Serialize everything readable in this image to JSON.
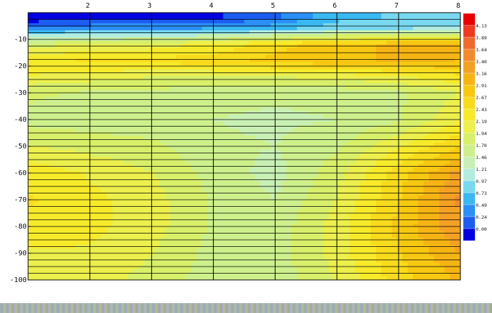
{
  "chart_data": {
    "type": "heatmap",
    "title": "",
    "xlabel": "",
    "ylabel": "",
    "x_ticks": [
      2,
      3,
      4,
      5,
      6,
      7,
      8
    ],
    "y_ticks": [
      -10,
      -20,
      -30,
      -40,
      -50,
      -60,
      -70,
      -80,
      -90,
      -100
    ],
    "x_tick_labels": [
      "2",
      "3",
      "4",
      "5",
      "6",
      "7",
      "8"
    ],
    "y_tick_labels": [
      "-10",
      "-20",
      "-30",
      "-40",
      "-50",
      "-60",
      "-70",
      "-80",
      "-90",
      "-100"
    ],
    "xlim": [
      1,
      8
    ],
    "ylim": [
      -100,
      0
    ],
    "x_grid": true,
    "y_grid_step": 2.5,
    "colorbar": {
      "levels": [
        0.0,
        0.24,
        0.49,
        0.73,
        0.97,
        1.21,
        1.46,
        1.7,
        1.94,
        2.19,
        2.43,
        2.67,
        2.91,
        3.16,
        3.4,
        3.64,
        3.89,
        4.13
      ],
      "labels": [
        "0.00",
        "0.24",
        "0.49",
        "0.73",
        "0.97",
        "1.21",
        "1.46",
        "1.70",
        "1.94",
        "2.19",
        "2.43",
        "2.67",
        "2.91",
        "3.16",
        "3.40",
        "3.64",
        "3.89",
        "4.13"
      ],
      "colors": [
        "#0000e0",
        "#1c5cf0",
        "#2b8ff5",
        "#3ab8f2",
        "#78d8f0",
        "#b2ecdf",
        "#c8f0b4",
        "#cdf08c",
        "#d8ef6a",
        "#ecef4c",
        "#f7ea2a",
        "#f8db1c",
        "#f7c812",
        "#f5b414",
        "#f4a024",
        "#f28a30",
        "#f06a30",
        "#ee3a1e",
        "#e80000"
      ]
    },
    "depths": [
      -2,
      -6,
      -12,
      -18,
      -24,
      -30,
      -40,
      -50,
      -60,
      -70,
      -80,
      -90,
      -100
    ],
    "x": [
      1,
      2,
      3,
      4,
      5,
      6,
      7,
      8
    ],
    "values": [
      [
        0.05,
        0.1,
        0.15,
        0.2,
        0.45,
        0.9,
        1.0,
        1.1
      ],
      [
        0.6,
        0.7,
        0.7,
        0.75,
        0.9,
        1.1,
        1.2,
        1.25
      ],
      [
        2.1,
        2.2,
        2.3,
        2.5,
        2.8,
        3.1,
        3.2,
        3.3
      ],
      [
        2.65,
        2.7,
        2.75,
        2.8,
        3.0,
        3.1,
        3.2,
        3.15
      ],
      [
        2.4,
        2.3,
        2.2,
        2.2,
        2.2,
        2.25,
        2.4,
        2.6
      ],
      [
        2.0,
        1.9,
        1.85,
        1.8,
        1.75,
        1.8,
        1.9,
        2.2
      ],
      [
        1.85,
        1.8,
        1.8,
        1.7,
        1.65,
        1.7,
        1.9,
        2.4
      ],
      [
        2.2,
        2.1,
        2.0,
        1.75,
        1.7,
        1.9,
        2.4,
        2.9
      ],
      [
        2.6,
        2.4,
        2.2,
        1.85,
        1.6,
        2.1,
        2.8,
        3.5
      ],
      [
        2.7,
        2.5,
        2.3,
        1.9,
        1.7,
        2.2,
        2.9,
        3.7
      ],
      [
        2.6,
        2.5,
        2.3,
        1.9,
        1.8,
        2.3,
        3.0,
        3.6
      ],
      [
        2.4,
        2.4,
        2.2,
        1.85,
        1.8,
        2.3,
        2.9,
        3.4
      ],
      [
        2.2,
        2.3,
        2.1,
        1.8,
        1.8,
        2.2,
        2.8,
        3.2
      ]
    ]
  }
}
